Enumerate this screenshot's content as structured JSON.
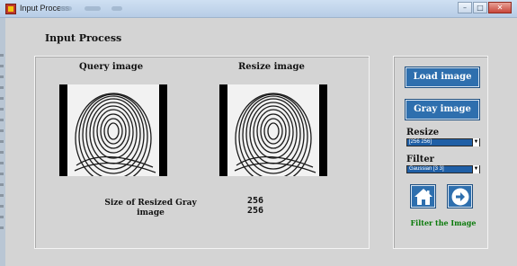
{
  "window": {
    "title": "Input Process",
    "app_icon": "matlab-figure-icon"
  },
  "heading": "Input Process",
  "images": {
    "query_caption": "Query image",
    "resize_caption": "Resize image",
    "query_icon": "fingerprint-image",
    "resize_icon": "fingerprint-image"
  },
  "info": {
    "size_label": "Size of Resized Gray image",
    "width": "256",
    "height": "256"
  },
  "controls": {
    "load_label": "Load image",
    "gray_label": "Gray image",
    "resize_label": "Resize",
    "resize_selected": "[256 256]",
    "filter_label": "Filter",
    "filter_selected": "Gaussian [3 3]",
    "home_icon": "home-icon",
    "next_icon": "arrow-right-circle-icon",
    "status": "Filter the Image"
  },
  "colors": {
    "button_bg": "#2e6fae",
    "select_bg": "#1f5fa6",
    "status_text": "#0a7a0a",
    "panel_bg": "#d4d4d4"
  }
}
